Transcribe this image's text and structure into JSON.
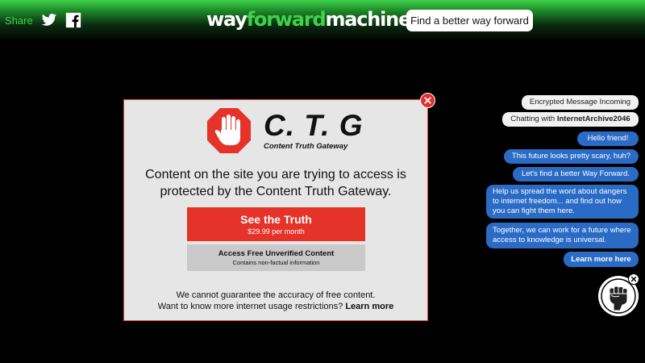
{
  "header": {
    "share_label": "Share",
    "brand_left": "way",
    "brand_mid": "forward",
    "brand_right": "machine",
    "cta_label": "Find a better way forward",
    "icons": [
      "twitter-icon",
      "facebook-icon"
    ]
  },
  "modal": {
    "title": "C. T. G",
    "subtitle": "Content Truth Gateway",
    "message": "Content on the site you are trying to access is protected by the Content Truth Gateway.",
    "primary_button": {
      "label": "See the Truth",
      "price": "$29.99 per month"
    },
    "secondary_button": {
      "label": "Access Free Unverified Content",
      "sublabel": "Contains non-factual information"
    },
    "footer_line1": "We cannot guarantee the accuracy of free content.",
    "footer_line2": "Want to know more internet usage restrictions?",
    "footer_link": "Learn more",
    "icons": [
      "stop-hand-icon",
      "close-icon"
    ]
  },
  "chat": {
    "status": "Encrypted Message Incoming",
    "chatting_prefix": "Chatting with",
    "chatting_name": "InternetArchive2046",
    "messages": [
      "Hello friend!",
      "This future looks pretty scary, huh?",
      "Let's find a better Way Forward.",
      "Help us spread the word about dangers to internet freedom... and find out how you can fight them here.",
      "Together, we can work for a future where access to knowledge is universal."
    ],
    "learn_more": "Learn more here",
    "icons": [
      "fist-icon",
      "close-icon"
    ]
  },
  "colors": {
    "accent_green": "#3fd24a",
    "chat_blue": "#2a6bc6",
    "cta_red": "#e63329",
    "background": "#000000"
  }
}
